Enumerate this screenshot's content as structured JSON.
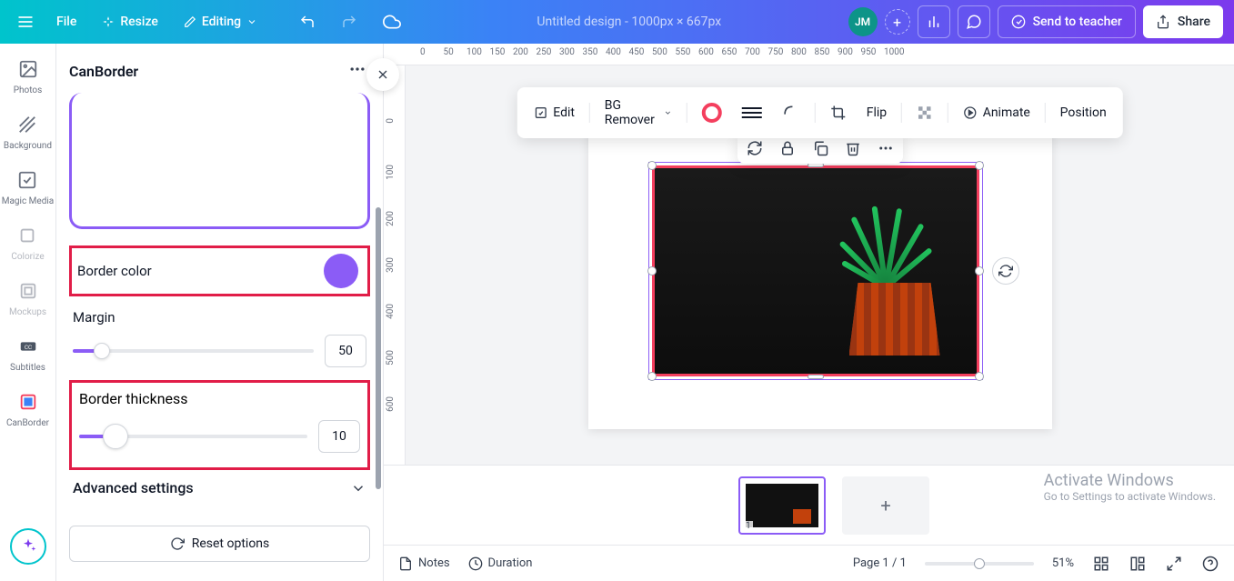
{
  "topbar": {
    "file": "File",
    "resize": "Resize",
    "editing": "Editing",
    "doc_title": "Untitled design - 1000px × 667px",
    "avatar_initials": "JM",
    "send_to_teacher": "Send to teacher",
    "share": "Share"
  },
  "rail": {
    "photos": "Photos",
    "background": "Background",
    "magic_media": "Magic Media",
    "colorize": "Colorize",
    "mockups": "Mockups",
    "subtitles": "Subtitles",
    "canborder": "CanBorder"
  },
  "panel": {
    "title": "CanBorder",
    "border_color_label": "Border color",
    "border_color_value": "#8b5cf6",
    "margin_label": "Margin",
    "margin_value": "50",
    "thickness_label": "Border thickness",
    "thickness_value": "10",
    "advanced_label": "Advanced settings",
    "reset_label": "Reset options"
  },
  "context_toolbar": {
    "edit": "Edit",
    "bg_remover": "BG Remover",
    "flip": "Flip",
    "animate": "Animate",
    "position": "Position"
  },
  "ruler_h": [
    "0",
    "50",
    "100",
    "150",
    "200",
    "250",
    "300",
    "350",
    "400",
    "450",
    "500",
    "550",
    "600",
    "650",
    "700",
    "750",
    "800",
    "850",
    "900",
    "950",
    "1000"
  ],
  "ruler_v": [
    "0",
    "100",
    "200",
    "300",
    "400",
    "500",
    "600"
  ],
  "pages": {
    "thumb_number": "1"
  },
  "windows": {
    "title": "Activate Windows",
    "subtitle": "Go to Settings to activate Windows."
  },
  "bottom": {
    "notes": "Notes",
    "duration": "Duration",
    "page_indicator": "Page 1 / 1",
    "zoom": "51%"
  }
}
